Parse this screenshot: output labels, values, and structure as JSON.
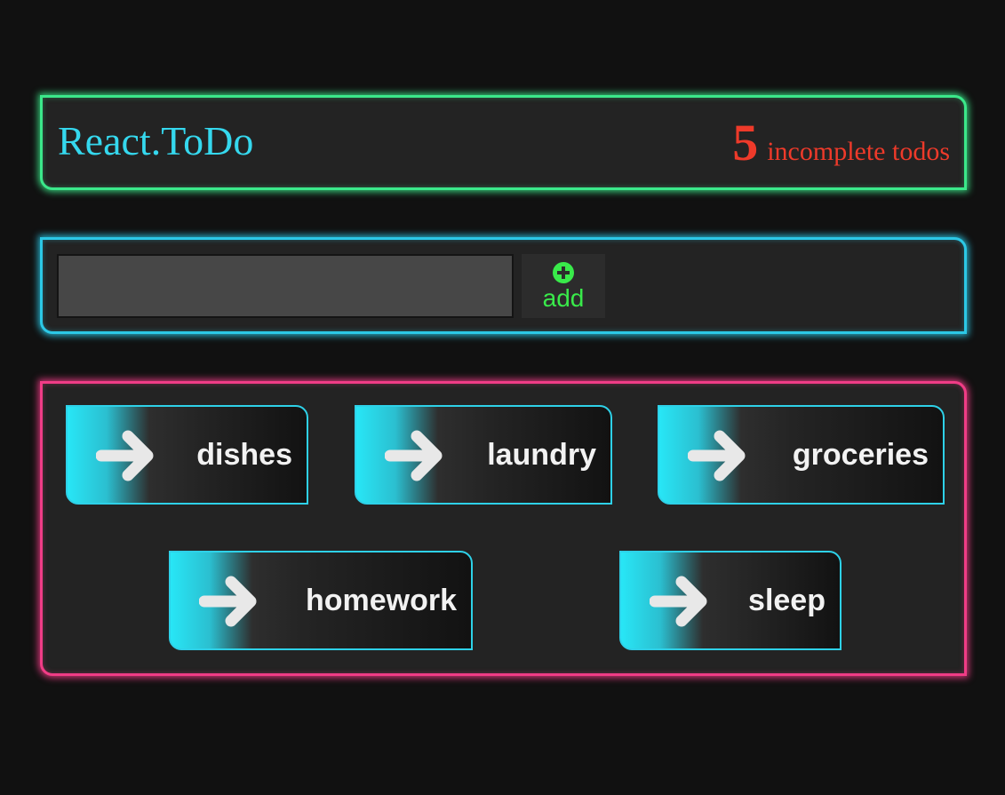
{
  "colors": {
    "background": "#111111",
    "panel": "#232323",
    "header_border": "#3be88a",
    "form_border": "#2cc8e6",
    "list_border": "#f03c86",
    "title": "#35d8ee",
    "counter": "#ee3a2a",
    "add": "#39ea4a",
    "todo_accent": "#2ed1e8"
  },
  "header": {
    "title": "React.ToDo",
    "count": "5",
    "count_label": "incomplete todos"
  },
  "form": {
    "input_value": "",
    "add_icon": "plus-circle-icon",
    "add_label": "add"
  },
  "todos": [
    {
      "label": "dishes",
      "icon": "arrow-right-icon"
    },
    {
      "label": "laundry",
      "icon": "arrow-right-icon"
    },
    {
      "label": "groceries",
      "icon": "arrow-right-icon"
    },
    {
      "label": "homework",
      "icon": "arrow-right-icon"
    },
    {
      "label": "sleep",
      "icon": "arrow-right-icon"
    }
  ]
}
